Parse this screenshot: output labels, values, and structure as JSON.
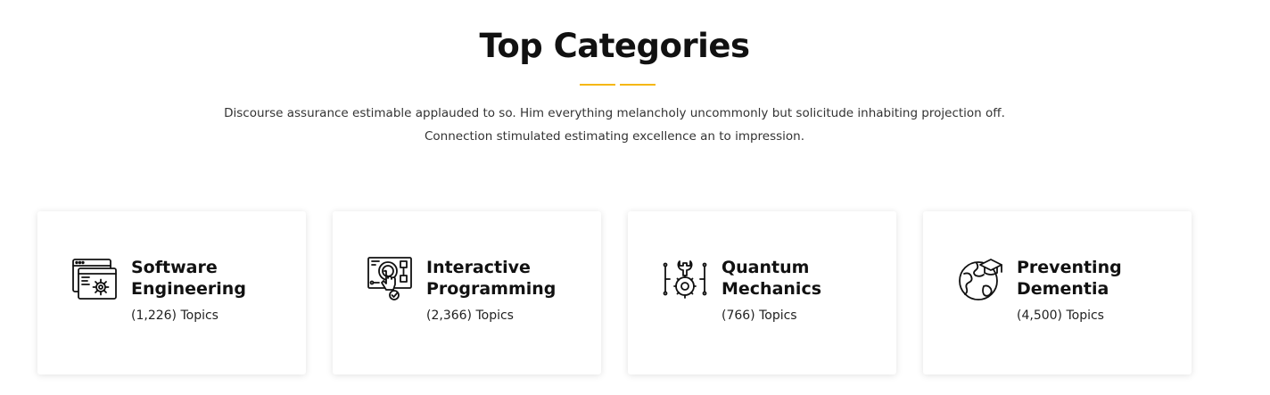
{
  "section": {
    "title": "Top Categories",
    "intro_line_1": "Discourse assurance estimable applauded to so. Him everything melancholy uncommonly but solicitude inhabiting projection off.",
    "intro_line_2": "Connection stimulated estimating excellence an to impression."
  },
  "colors": {
    "accent": "#f5b710",
    "title": "#111111",
    "body_text": "#333333"
  },
  "categories": [
    {
      "title": "Software Engineering",
      "count": "(1,226) Topics",
      "icon": "software-window-gear-icon"
    },
    {
      "title": "Interactive Programming",
      "count": "(2,366) Topics",
      "icon": "touch-circuit-board-icon"
    },
    {
      "title": "Quantum Mechanics",
      "count": "(766) Topics",
      "icon": "wrench-gear-circuit-icon"
    },
    {
      "title": "Preventing Dementia",
      "count": "(4,500) Topics",
      "icon": "globe-graduation-cap-icon"
    }
  ]
}
